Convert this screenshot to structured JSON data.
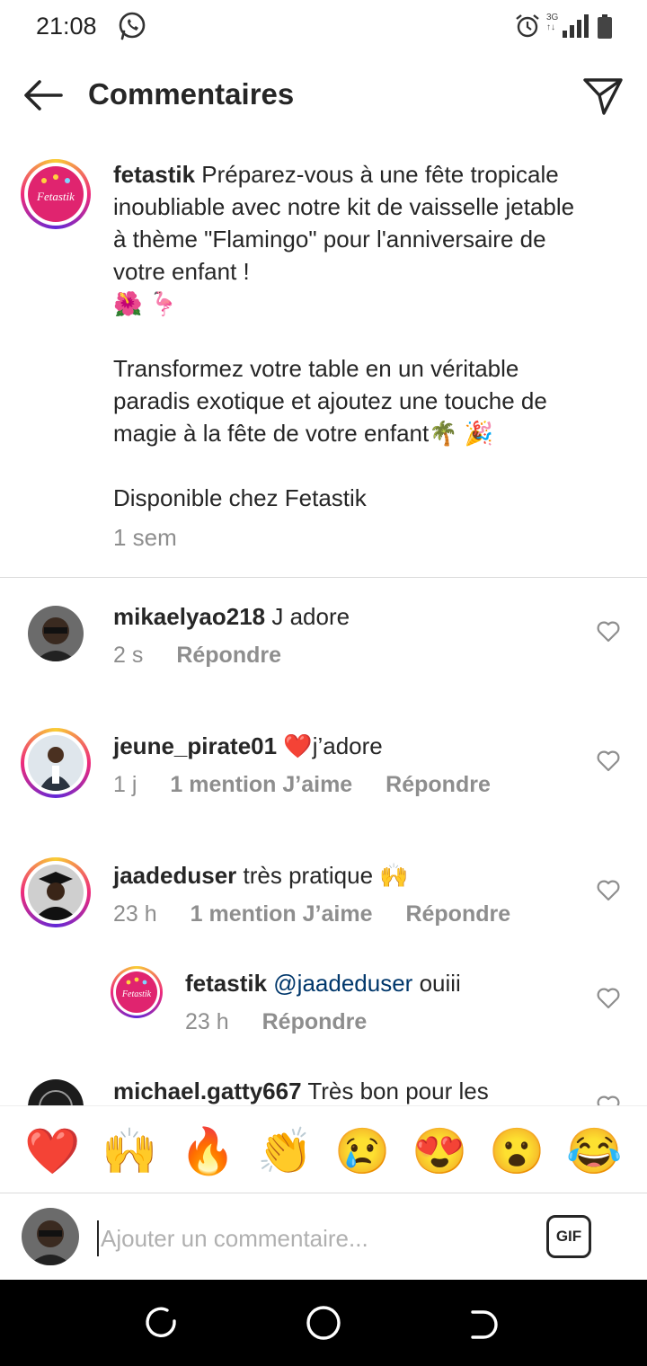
{
  "status_bar": {
    "time": "21:08",
    "network": "3G",
    "network_sub": "↑↓"
  },
  "header": {
    "title": "Commentaires"
  },
  "post": {
    "username": "fetastik",
    "avatar_text": "Fetastik",
    "caption_line1": "Préparez-vous à une fête tropicale inoubliable avec notre kit de vaisselle jetable à thème \"Flamingo\" pour l'anniversaire de votre enfant !",
    "caption_emojis1": "🌺 🦩",
    "caption_para2": "Transformez votre table en un véritable paradis exotique et ajoutez une touche de magie à la fête de votre enfant",
    "caption_emojis2": "🌴 🎉",
    "caption_para3": "Disponible chez Fetastik",
    "time": "1 sem"
  },
  "comments": [
    {
      "username": "mikaelyao218",
      "text": "J adore",
      "time": "2 s",
      "likes": "",
      "reply_label": "Répondre"
    },
    {
      "username": "jeune_pirate01",
      "emoji": "❤️",
      "text": "j’adore",
      "time": "1 j",
      "likes": "1 mention J’aime",
      "reply_label": "Répondre"
    },
    {
      "username": "jaadeduser",
      "text": "très pratique",
      "emoji": "🙌",
      "time": "23 h",
      "likes": "1 mention J’aime",
      "reply_label": "Répondre"
    },
    {
      "username": "fetastik",
      "mention": "@jaadeduser",
      "text": "ouiii",
      "time": "23 h",
      "reply_label": "Répondre"
    },
    {
      "username": "michael.gatty667",
      "text": "Très bon pour les"
    }
  ],
  "emoji_reactions": [
    "❤️",
    "🙌",
    "🔥",
    "👏",
    "😢",
    "😍",
    "😮",
    "😂"
  ],
  "input": {
    "placeholder": "Ajouter un commentaire...",
    "gif_label": "GIF"
  }
}
